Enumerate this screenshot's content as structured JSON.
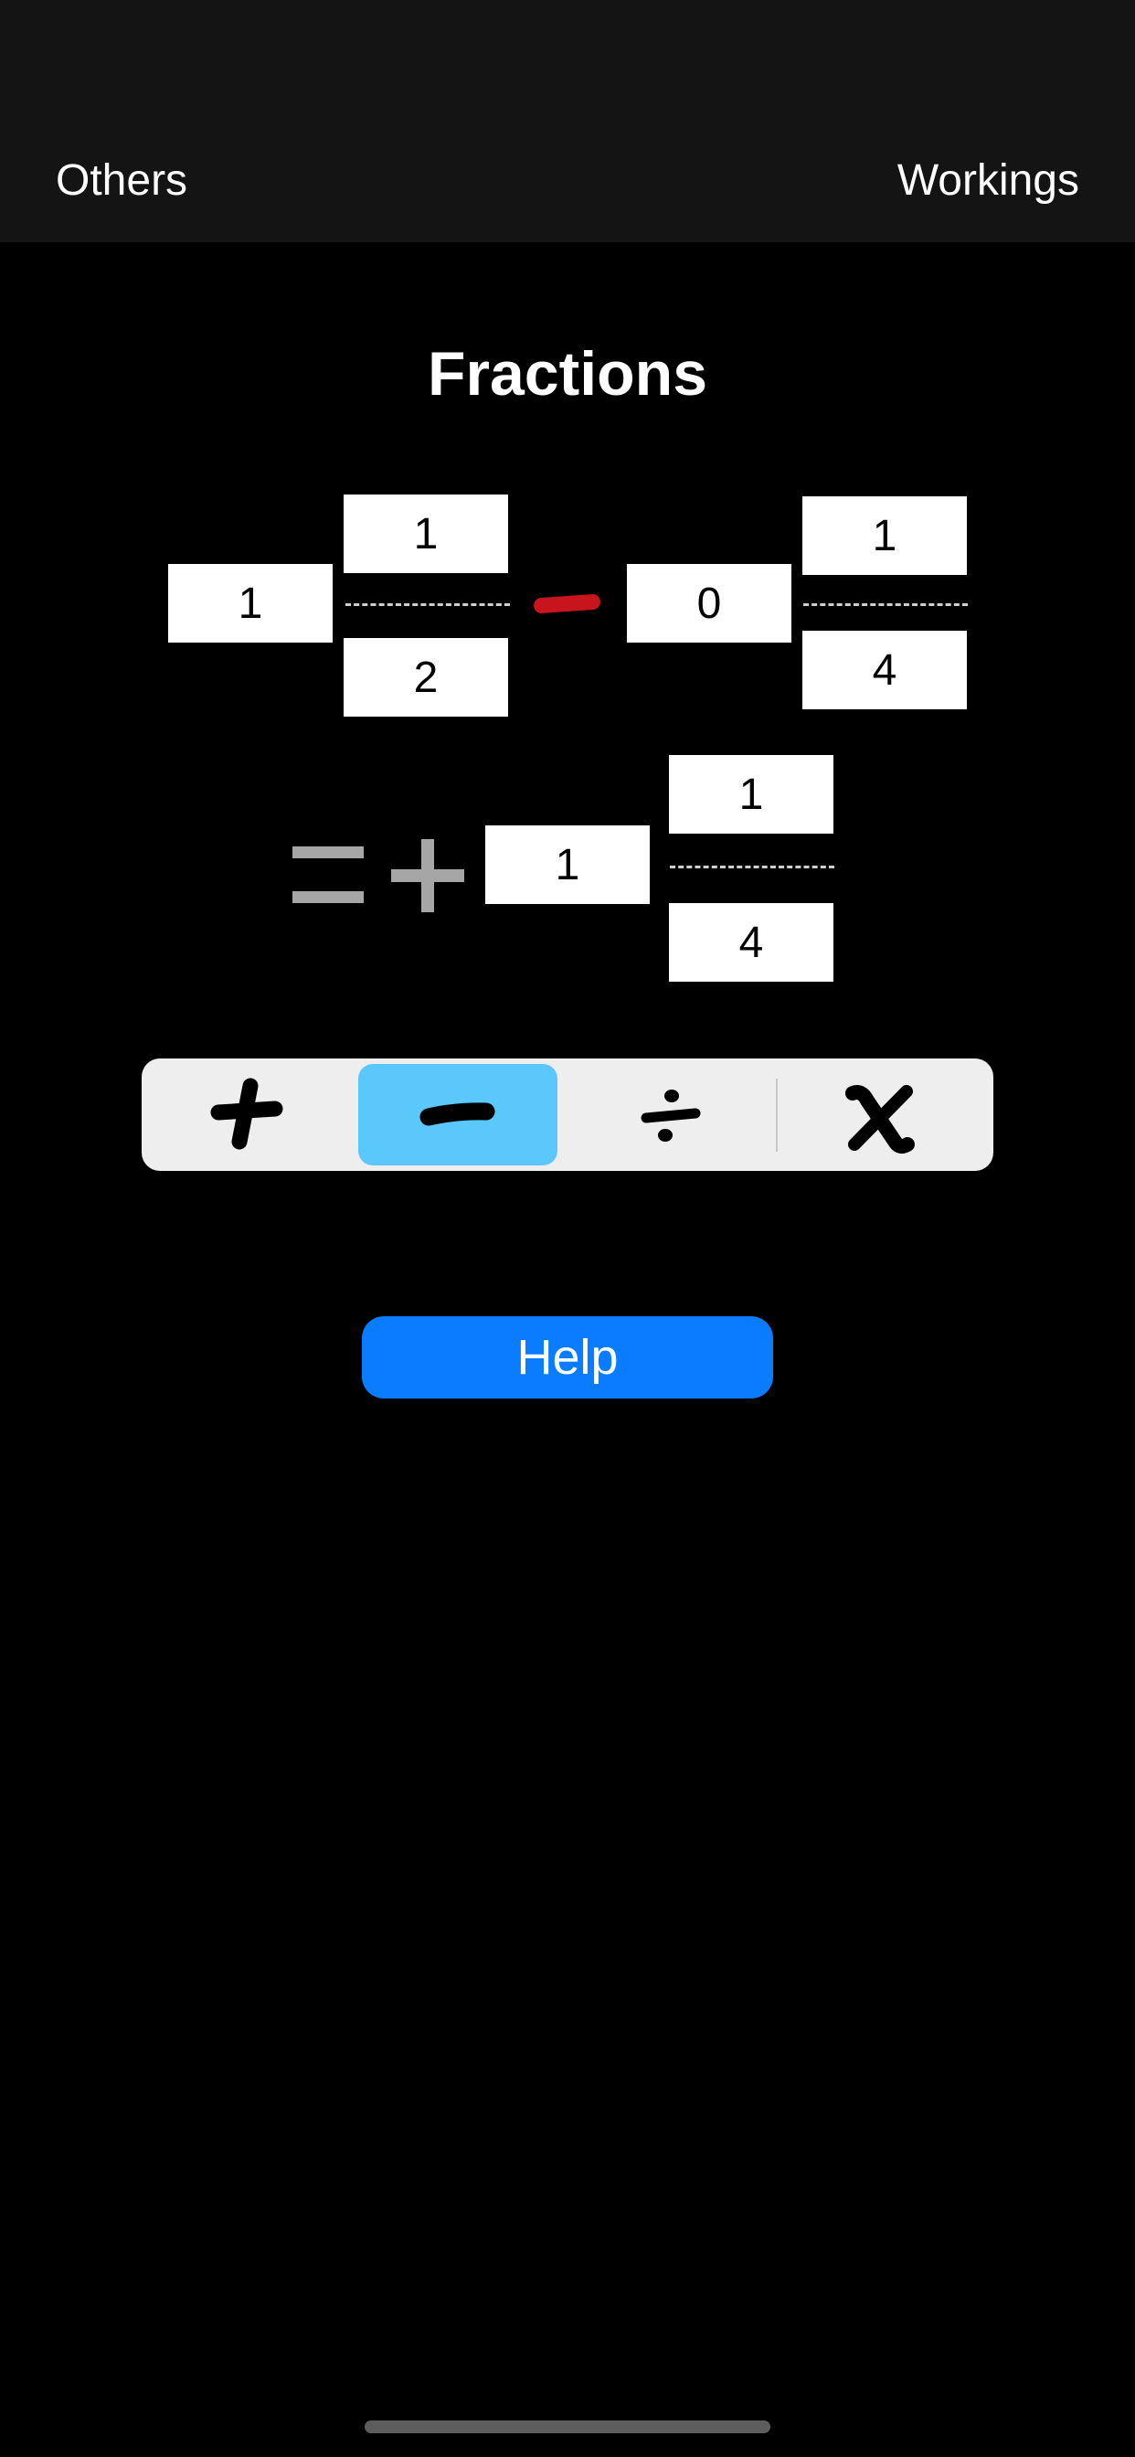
{
  "navbar": {
    "left_label": "Others",
    "right_label": "Workings"
  },
  "title": "Fractions",
  "operand1": {
    "whole": "1",
    "numerator": "1",
    "denominator": "2"
  },
  "operand2": {
    "whole": "0",
    "numerator": "1",
    "denominator": "4"
  },
  "result": {
    "whole": "1",
    "numerator": "1",
    "denominator": "4"
  },
  "operator_color": "#c8141c",
  "segments": [
    {
      "name": "add",
      "selected": false
    },
    {
      "name": "subtract",
      "selected": true
    },
    {
      "name": "divide",
      "selected": false
    },
    {
      "name": "multiply",
      "selected": false
    }
  ],
  "colors": {
    "selected_segment": "#5ac8fa",
    "help_button": "#0a7cff",
    "result_signs": "#a6a6a6"
  },
  "help_label": "Help"
}
